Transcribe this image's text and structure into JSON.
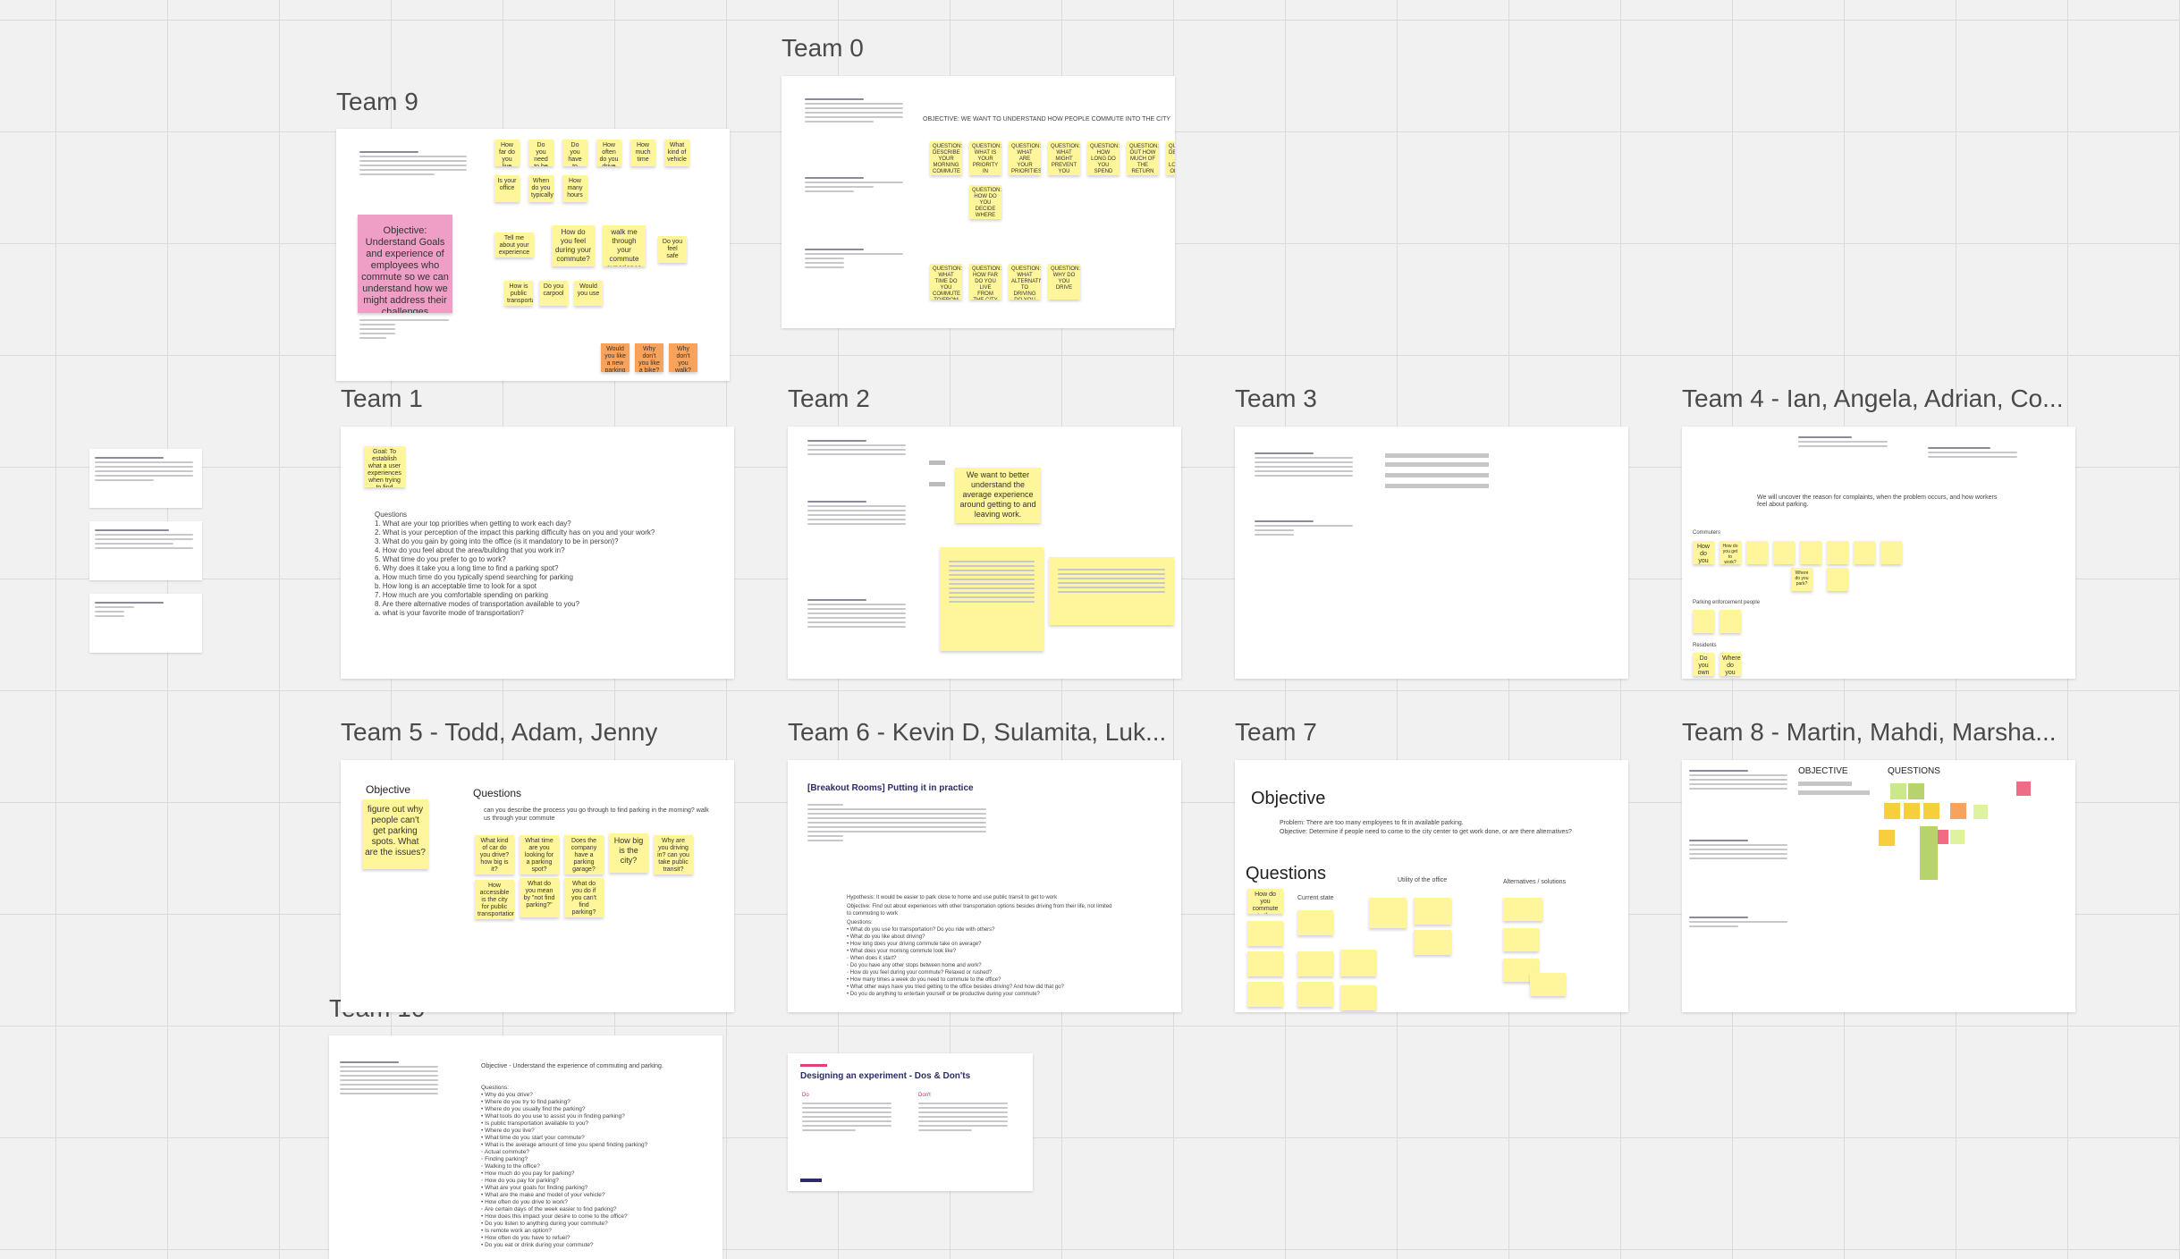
{
  "board": {
    "teams": {
      "t0": "Team 0",
      "t9": "Team 9",
      "t1": "Team 1",
      "t2": "Team 2",
      "t3": "Team 3",
      "t4": "Team 4 - Ian, Angela, Adrian, Co...",
      "t5": "Team 5 - Todd, Adam, Jenny",
      "t6": "Team 6 - Kevin D, Sulamita, Luk...",
      "t7": "Team 7",
      "t8": "Team 8 - Martin, Mahdi, Marsha...",
      "t10": "Team 10"
    }
  },
  "team0": {
    "objective": "OBJECTIVE: WE WANT TO UNDERSTAND HOW PEOPLE COMMUTE INTO THE CITY",
    "q1": "QUESTION: DESCRIBE YOUR MORNING COMMUTE",
    "q2": "QUESTION: WHAT IS YOUR PRIORITY IN LOCATING A PARKING SPOT?",
    "q3": "QUESTION: WHAT ARE YOUR PRIORITIES IN FINDING A PARKING SPOT",
    "q4": "QUESTION: WHAT MIGHT PREVENT YOU FROM LOOKING FOR A PARKING SPOT",
    "q5": "QUESTION: HOW LONG DO YOU SPEND LOOKING FOR A PARKING SPOT",
    "q6": "QUESTION: OUT HOW MUCH OF THE RETURN TIME IS IT SPENT IN THE CAR",
    "q7": "QUESTION: DESCRIBE THE LOCATION OF YOUR LAST PARKING SPOT",
    "q8": "QUESTION: HOW DO YOU DECIDE WHERE TO PARK",
    "q9": "QUESTION: WHAT TIME DO YOU COMMUTE TO/FROM CITY",
    "q10": "QUESTION: HOW FAR DO YOU LIVE FROM THE CITY",
    "q11": "QUESTION: WHAT ALTERNATIVE TO DRIVING DO YOU HAVE",
    "q12": "QUESTION: WHY DO YOU DRIVE"
  },
  "team9": {
    "objective": "Objective: Understand Goals and experience of employees who commute so we can understand how we might address their challenges",
    "feel": "How do you feel during your commute?",
    "walk": "walk me through your commute experience",
    "o1": "Would you like a new parking service?",
    "o2": "Why don't you like a bike?",
    "o3": "Why don't you walk?"
  },
  "team1": {
    "sticky": "Goal: To establish what a user experiences when trying to find parking near work",
    "questions": "Questions\n1. What are your top priorities when getting to work each day?\n2. What is your perception of the impact this parking difficulty has on you and your work?\n3. What do you gain by going into the office (is it mandatory to be in person)?\n4. How do you feel about the area/building that you work in?\n5. What time do you prefer to go to work?\n6. Why does it take you a long time to find a parking spot?\n      a. How much time do you typically spend searching for parking\n      b. How long is an acceptable time to look for a spot\n7. How much are you comfortable spending on parking\n8. Are there alternative modes of transportation available to you?\n      a. what is your favorite mode of transportation?"
  },
  "team2": {
    "sticky": "We want to better understand the average experience around getting to and leaving work."
  },
  "team4": {
    "desc": "We will uncover the reason for complaints, when the problem occurs, and how workers feel about parking.",
    "commuters": "Commuters",
    "enforcement": "Parking enforcement people",
    "residents": "Residents",
    "s1": "How do you get to work?",
    "s2": "Where do you park?"
  },
  "team5": {
    "objective_label": "Objective",
    "objective": "figure out why people can't get parking spots. What are the issues?",
    "questions_label": "Questions",
    "first_q": "can you describe the process you go through to find parking in the morning? walk us through your commute",
    "q1": "What kind of car do you drive? how big is it?",
    "q2": "What time are you looking for a parking spot?",
    "q3": "Does the company have a parking garage?",
    "q4": "How big is the city?",
    "q5": "Why are you driving in? can you take public transit?",
    "q6": "How accessible is the city for public transportation?",
    "q7": "What do you mean by \"not find parking?\"",
    "q8": "What do you do if you can't find parking?"
  },
  "team6": {
    "title": "[Breakout Rooms] Putting it in practice",
    "hypothesis": "Hypothesis: It would be easier to park close to home and use public transit to get to work",
    "objective": "Objective: Find out about experiences with other transportation options besides driving from their life, not limited to commuting to work",
    "questions": "Questions:\n• What do you use for transportation? Do you ride with others?\n• What do you like about driving?\n• How long does your driving commute take on average?\n• What does your morning commute look like?\n      ◦ When does it start?\n      ◦ Do you have any other stops between home and work?\n      ◦ How do you feel during your commute? Relaxed or rushed?\n• How many times a week do you need to commute to the office?\n• What other ways have you tried getting to the office besides driving? And how did that go?\n• Do you do anything to entertain yourself or be productive during your commute?"
  },
  "team7": {
    "objective_label": "Objective",
    "problem": "Problem: There are too many employees to fit in available parking.",
    "objective": "Objective: Determine if people need to come to the city center to get work done, or are there alternatives?",
    "questions_label": "Questions",
    "current": "Current state",
    "utility": "Utility of the office",
    "alternatives": "Alternatives / solutions"
  },
  "team8": {
    "objective": "OBJECTIVE",
    "questions": "QUESTIONS"
  },
  "team10": {
    "objective": "Objective - Understand the experience of commuting and parking.",
    "questions": "Questions:\n• Why do you drive?\n• Where do you try to find parking?\n• Where do you usually find the parking?\n• What tools do you use to assist you in finding parking?\n• Is public transportation available to you?\n• Where do you live?\n• What time do you start your commute?\n• What is the average amount of time you spend finding parking?\n      ◦ Actual commute?\n      ◦ Finding parking?\n      ◦ Walking to the office?\n• How much do you pay for parking?\n      ◦ How do you pay for parking?\n• What are your goals for finding parking?\n• What are the make and model of your vehicle?\n• How often do you drive to work?\n      ◦ Are certain days of the week easier to find parking?\n• How does this impact your desire to come to the office?\n• Do you listen to anything during your commute?\n• Is remote work an option?\n• How often do you have to refuel?\n• Do you eat or drink during your commute?"
  },
  "dosdonts": {
    "title": "Designing an experiment - Dos & Don'ts",
    "do": "Do",
    "dont": "Don't"
  },
  "colors": {
    "sticky": "#fff59a",
    "pink": "#ef9fc5",
    "orange": "#f7a35b",
    "canvas": "#f1f1f1"
  }
}
